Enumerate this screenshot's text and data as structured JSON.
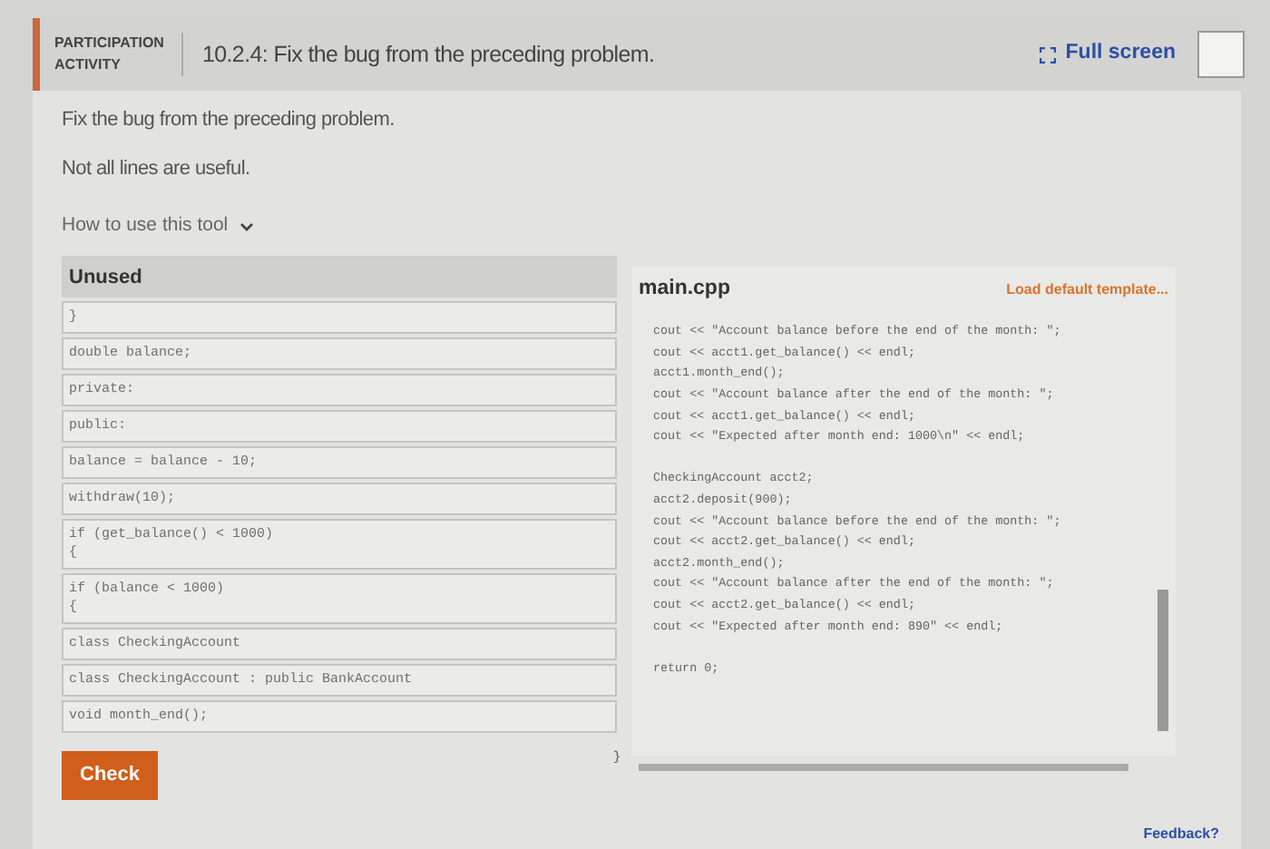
{
  "header": {
    "tag_lines": [
      "PARTICIPATION",
      "ACTIVITY"
    ],
    "title": "10.2.4: Fix the bug from the preceding problem.",
    "fullscreen": "Full screen"
  },
  "instructions": [
    "Fix the bug from the preceding problem.",
    "Not all lines are useful."
  ],
  "help_toggle": {
    "label": "How to use this tool",
    "expanded": false
  },
  "unused": {
    "title": "Unused",
    "blocks": [
      {
        "lines": [
          "}"
        ]
      },
      {
        "lines": [
          "double balance;"
        ]
      },
      {
        "lines": [
          "private:"
        ]
      },
      {
        "lines": [
          "public:"
        ]
      },
      {
        "lines": [
          "balance = balance - 10;"
        ]
      },
      {
        "lines": [
          "withdraw(10);"
        ]
      },
      {
        "lines": [
          "if (get_balance() < 1000)",
          "{"
        ]
      },
      {
        "lines": [
          "if (balance < 1000)",
          "{"
        ]
      },
      {
        "lines": [
          "class CheckingAccount"
        ]
      },
      {
        "lines": [
          "class CheckingAccount : public BankAccount"
        ]
      },
      {
        "lines": [
          "void month_end();"
        ]
      }
    ]
  },
  "check_button": "Check",
  "editor": {
    "filename": "main.cpp",
    "load_link": "Load default template...",
    "paragraphs": [
      [
        "cout << \"Account balance before the end of the month: \";",
        "cout << acct1.get_balance() << endl;",
        "acct1.month_end();",
        "cout << \"Account balance after the end of the month: \";",
        "cout << acct1.get_balance() << endl;",
        "cout << \"Expected after month end: 1000\\n\" << endl;"
      ],
      [
        "CheckingAccount acct2;",
        "acct2.deposit(900);",
        "cout << \"Account balance before the end of the month: \";",
        "cout << acct2.get_balance() << endl;",
        "acct2.month_end();",
        "cout << \"Account balance after the end of the month: \";",
        "cout << acct2.get_balance() << endl;",
        "cout << \"Expected after month end: 890\" << endl;"
      ],
      [
        "return 0;"
      ]
    ],
    "gutter_brace": "}"
  },
  "feedback": "Feedback?"
}
